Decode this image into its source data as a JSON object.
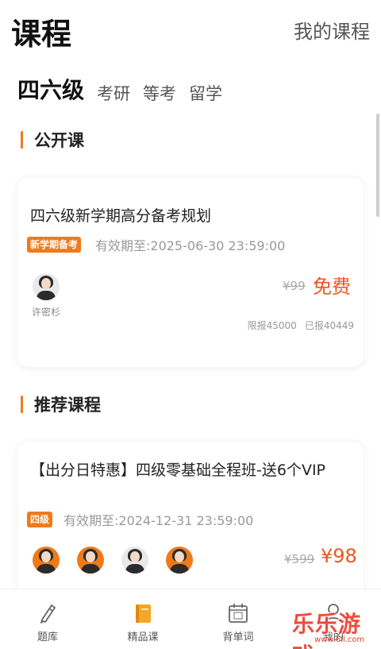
{
  "header": {
    "title": "课程",
    "my_courses": "我的课程"
  },
  "category_tabs": [
    {
      "label": "四六级",
      "active": true
    },
    {
      "label": "考研",
      "active": false
    },
    {
      "label": "等考",
      "active": false
    },
    {
      "label": "留学",
      "active": false
    }
  ],
  "sections": {
    "open": {
      "title": "公开课"
    },
    "recommended": {
      "title": "推荐课程"
    }
  },
  "open_course": {
    "title": "四六级新学期高分备考规划",
    "tag": "新学期备考",
    "validity": "有效期至:2025-06-30 23:59:00",
    "teachers": [
      {
        "name": "许密杉"
      }
    ],
    "original_price": "¥99",
    "price": "免费",
    "limit": "限报45000",
    "enrolled": "已报40449"
  },
  "recommended_course": {
    "title": "【出分日特惠】四级零基础全程班-送6个VIP",
    "tag": "四级",
    "validity": "有效期至:2024-12-31 23:59:00",
    "original_price": "¥599",
    "price": "¥98"
  },
  "bottom_nav": [
    {
      "label": "题库",
      "icon": "pencil-icon"
    },
    {
      "label": "精品课",
      "icon": "book-icon",
      "active": true
    },
    {
      "label": "背单词",
      "icon": "calendar-icon"
    },
    {
      "label": "我的",
      "icon": "user-icon"
    }
  ],
  "colors": {
    "accent": "#f07a1a",
    "price": "#f2541c",
    "watermark": "#e8402e"
  },
  "watermark": {
    "text": "乐乐游戏",
    "url": "www.6ll.com"
  }
}
